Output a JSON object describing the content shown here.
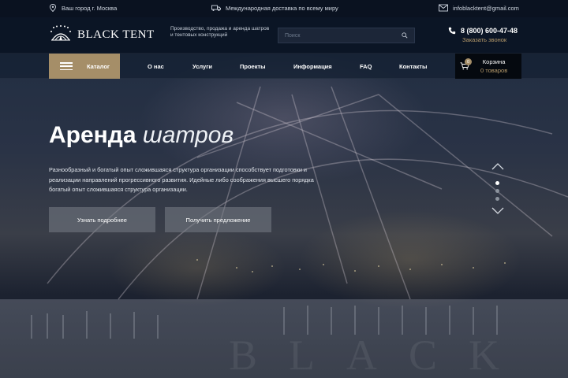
{
  "topbar": {
    "city": "Ваш город г. Москва",
    "delivery": "Международная доставка по всему миру",
    "email": "infoblacktent@gmail.com"
  },
  "header": {
    "logo_text": "BLACK TENT",
    "tagline": "Производство, продажа и аренда шатров и тентовых конструкций",
    "search_placeholder": "Поиск",
    "phone": "8 (800) 600-47-48",
    "callback": "Заказать звонок"
  },
  "nav": {
    "catalog": "Каталог",
    "items": [
      "О нас",
      "Услуги",
      "Проекты",
      "Информация",
      "FAQ",
      "Контакты"
    ],
    "cart_title": "Корзина",
    "cart_count": "0 товаров",
    "cart_badge": "0"
  },
  "hero": {
    "title_bold": "Аренда",
    "title_light": "шатров",
    "text": "Разнообразный и богатый опыт сложившаяся структура организации способствует подготовки и реализации направлений прогрессивного развития. Идейные либо соображения высшего порядка богатый опыт сложившаяся структура организации.",
    "btn_more": "Узнать подробнее",
    "btn_offer": "Получить предложение",
    "watermark": "BLACK TE"
  },
  "colors": {
    "accent": "#a58e68",
    "accent_text": "#b79b6b",
    "topbar_bg": "#0a1220",
    "cart_bg": "#05090f"
  },
  "icons": {
    "city": "location-pin-icon",
    "delivery": "truck-icon",
    "email": "envelope-icon",
    "search": "magnifier-icon",
    "phone": "phone-icon",
    "cart": "cart-icon",
    "catalog": "hamburger-icon"
  }
}
